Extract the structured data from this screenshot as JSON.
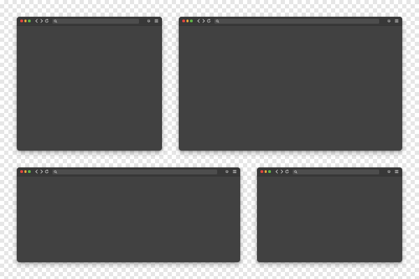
{
  "colors": {
    "window_body": "#414141",
    "toolbar": "#383838",
    "address_bar": "#4d4d4d",
    "icon": "#cfcfcf",
    "dot_close": "#e2463f",
    "dot_minimize": "#e9a83b",
    "dot_zoom": "#5fb547"
  },
  "windows": [
    {
      "id": "top-left",
      "address": ""
    },
    {
      "id": "top-right",
      "address": ""
    },
    {
      "id": "bottom-left",
      "address": ""
    },
    {
      "id": "bottom-right",
      "address": ""
    }
  ],
  "icons": [
    "back-icon",
    "forward-icon",
    "reload-icon",
    "search-icon",
    "settings-icon",
    "menu-icon"
  ]
}
